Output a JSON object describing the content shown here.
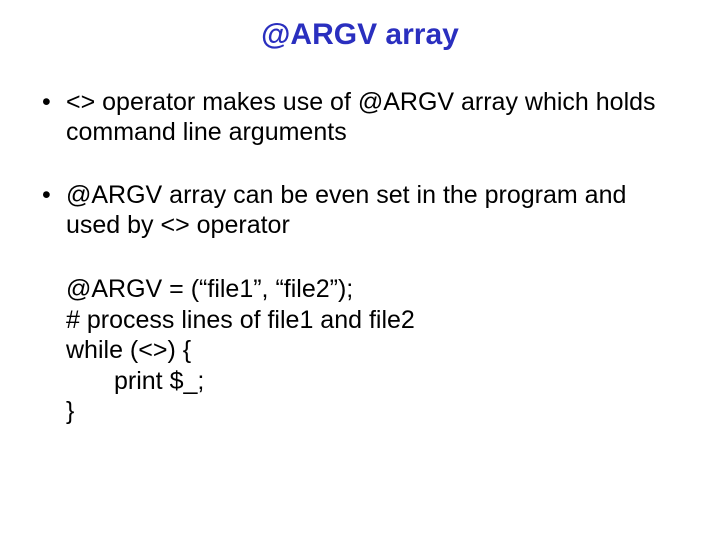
{
  "title": "@ARGV array",
  "bullets": [
    "<> operator makes use of @ARGV array which holds command line arguments",
    "@ARGV array can be even set in the program and used by <> operator"
  ],
  "code": {
    "l1": "@ARGV = (“file1”, “file2”);",
    "l2": "# process lines of file1 and file2",
    "l3": "while (<>) {",
    "l4": "print $_;",
    "l5": "}"
  }
}
